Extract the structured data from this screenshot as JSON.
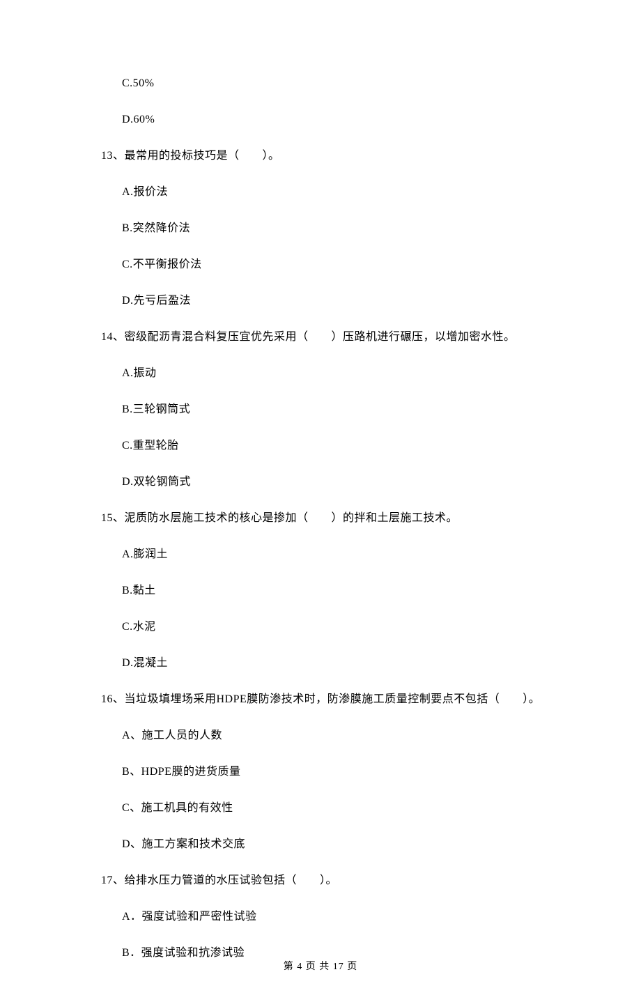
{
  "carryoverOptions": [
    "C.50%",
    "D.60%"
  ],
  "questions": [
    {
      "number": "13",
      "stem": "、最常用的投标技巧是（　　）。",
      "options": [
        "A.报价法",
        "B.突然降价法",
        "C.不平衡报价法",
        "D.先亏后盈法"
      ]
    },
    {
      "number": "14",
      "stem": "、密级配沥青混合料复压宜优先采用（　　）压路机进行碾压，以增加密水性。",
      "options": [
        "A.振动",
        "B.三轮钢筒式",
        "C.重型轮胎",
        "D.双轮钢筒式"
      ]
    },
    {
      "number": "15",
      "stem": "、泥质防水层施工技术的核心是掺加（　　）的拌和土层施工技术。",
      "options": [
        "A.膨润土",
        "B.黏土",
        "C.水泥",
        "D.混凝土"
      ]
    },
    {
      "number": "16",
      "stem": "、当垃圾填埋场采用HDPE膜防渗技术时，防渗膜施工质量控制要点不包括（　　）。",
      "options": [
        "A、施工人员的人数",
        "B、HDPE膜的进货质量",
        "C、施工机具的有效性",
        "D、施工方案和技术交底"
      ]
    },
    {
      "number": "17",
      "stem": "、给排水压力管道的水压试验包括（　　）。",
      "options": [
        "A．强度试验和严密性试验",
        "B．强度试验和抗渗试验"
      ]
    }
  ],
  "footer": "第 4 页 共 17 页"
}
